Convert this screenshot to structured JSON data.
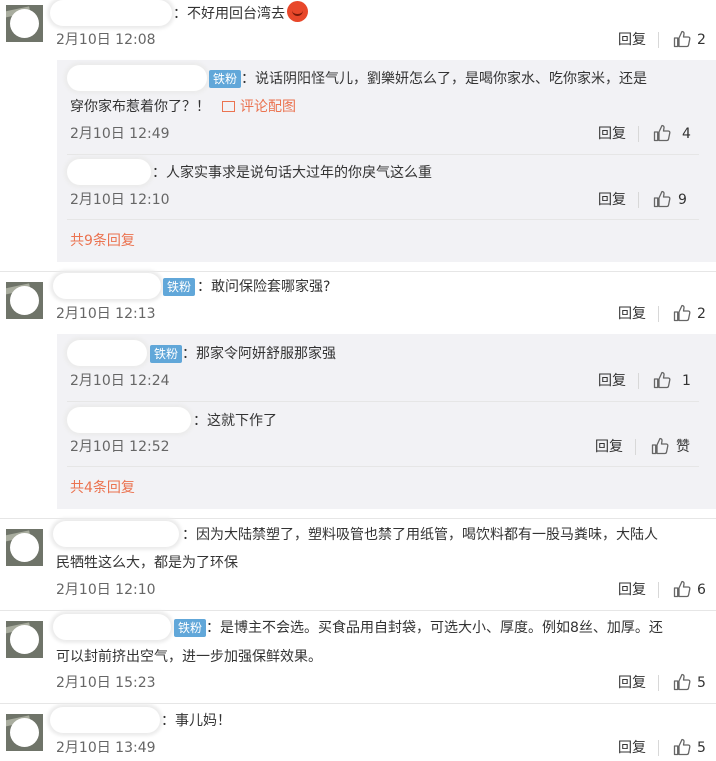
{
  "badge_label": "铁粉",
  "reply_label": "回复",
  "comments": [
    {
      "text": "：不好用回台湾去",
      "time": "2月10日 12:08",
      "likes": "2",
      "sub_replies": [
        {
          "text": "：说话阴阳怪气儿，劉樂妍怎么了，是喝你家水、吃你家米，还是",
          "text2": "穿你家布惹着你了？！",
          "pic_label": "评论配图",
          "time": "2月10日 12:49",
          "likes": "4"
        },
        {
          "text": "：人家实事求是说句话大过年的你戾气这么重",
          "time": "2月10日 12:10",
          "likes": "9"
        }
      ],
      "more": "共9条回复"
    },
    {
      "text": "：敢问保险套哪家强?",
      "time": "2月10日 12:13",
      "likes": "2",
      "sub_replies": [
        {
          "text": "：那家令阿妍舒服那家强",
          "time": "2月10日 12:24",
          "likes": "1"
        },
        {
          "text": "：这就下作了",
          "time": "2月10日 12:52",
          "likes": "赞"
        }
      ],
      "more": "共4条回复"
    },
    {
      "text": "：因为大陆禁塑了，塑料吸管也禁了用纸管，喝饮料都有一股马粪味，大陆人",
      "text2": "民牺牲这么大，都是为了环保",
      "time": "2月10日 12:10",
      "likes": "6"
    },
    {
      "text": "：是博主不会选。买食品用自封袋，可选大小、厚度。例如8丝、加厚。还",
      "text2": "可以封前挤出空气，进一步加强保鲜效果。",
      "time": "2月10日 15:23",
      "likes": "5"
    },
    {
      "text": "：事儿妈！",
      "time": "2月10日 13:49",
      "likes": "5"
    }
  ]
}
